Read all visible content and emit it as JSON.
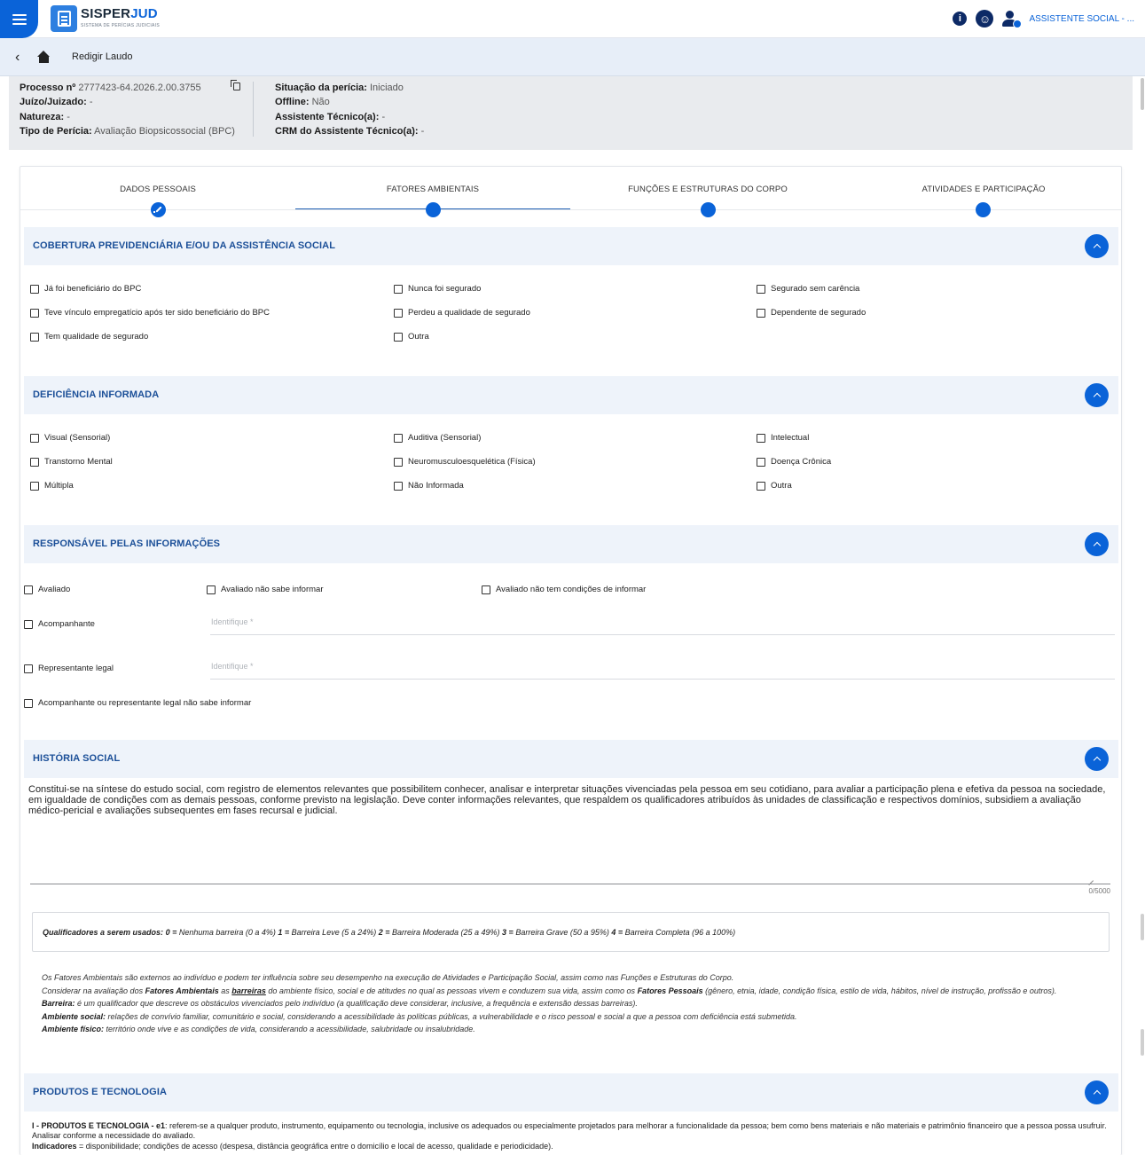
{
  "app": {
    "logo_main": "SISPER",
    "logo_accent": "JUD",
    "logo_sub": "SISTEMA DE PERÍCIAS JUDICIAIS",
    "user_name": "ASSISTENTE SOCIAL - ...",
    "info_icon": "info-icon",
    "accessibility_icon": "accessibility-icon"
  },
  "nav": {
    "title": "Redigir Laudo"
  },
  "process": {
    "numero_label": "Processo nº",
    "numero_value": "2777423-64.2026.2.00.3755",
    "juizo_label": "Juízo/Juizado:",
    "juizo_value": "-",
    "natureza_label": "Natureza:",
    "natureza_value": "-",
    "tipo_label": "Tipo de Perícia:",
    "tipo_value": "Avaliação Biopsicossocial (BPC)",
    "situacao_label": "Situação da perícia:",
    "situacao_value": "Iniciado",
    "offline_label": "Offline:",
    "offline_value": "Não",
    "assistente_label": "Assistente Técnico(a):",
    "assistente_value": "-",
    "crm_label": "CRM do Assistente Técnico(a):",
    "crm_value": "-"
  },
  "stepper": [
    {
      "label": "DADOS PESSOAIS"
    },
    {
      "label": "FATORES AMBIENTAIS"
    },
    {
      "label": "FUNÇÕES E ESTRUTURAS DO CORPO"
    },
    {
      "label": "ATIVIDADES E PARTICIPAÇÃO"
    }
  ],
  "cobertura": {
    "title": "COBERTURA PREVIDENCIÁRIA E/OU DA ASSISTÊNCIA SOCIAL",
    "options": [
      "Já foi beneficiário do BPC",
      "Nunca foi segurado",
      "Segurado sem carência",
      "Teve vínculo empregatício após ter sido beneficiário do BPC",
      "Perdeu a qualidade de segurado",
      "Dependente de segurado",
      "Tem qualidade de segurado",
      "Outra"
    ]
  },
  "deficiencia": {
    "title": "DEFICIÊNCIA INFORMADA",
    "options": [
      "Visual (Sensorial)",
      "Auditiva (Sensorial)",
      "Intelectual",
      "Transtorno Mental",
      "Neuromusculoesquelética (Física)",
      "Doença Crônica",
      "Múltipla",
      "Não Informada",
      "Outra"
    ]
  },
  "responsavel": {
    "title": "RESPONSÁVEL PELAS INFORMAÇÕES",
    "avaliado": "Avaliado",
    "avaliado_nao_sabe": "Avaliado não sabe informar",
    "avaliado_sem_condicoes": "Avaliado não tem condições de informar",
    "acompanhante": "Acompanhante",
    "representante": "Representante legal",
    "identifique_placeholder": "Identifique *",
    "nao_sabe": "Acompanhante ou representante legal não sabe informar"
  },
  "historia": {
    "title": "HISTÓRIA SOCIAL",
    "text": "Constitui-se na síntese do estudo social, com registro de elementos relevantes que possibilitem conhecer, analisar e interpretar situações vivenciadas pela pessoa em seu cotidiano, para avaliar a participação plena e efetiva da pessoa na sociedade, em igualdade de condições com as demais pessoas, conforme previsto na legislação. Deve conter informações relevantes, que respaldem os qualificadores atribuídos às unidades de classificação e respectivos domínios, subsidiem a avaliação médico-pericial e avaliações subsequentes em fases recursal e judicial.",
    "counter": "0/5000"
  },
  "qualificadores": {
    "label": "Qualificadores a serem usados:",
    "q0k": "0 =",
    "q0": " Nenhuma barreira (0 a 4%) ",
    "q1k": "1 =",
    "q1": " Barreira Leve (5 a 24%) ",
    "q2k": "2 =",
    "q2": " Barreira Moderada (25 a 49%)  ",
    "q3k": "3 =",
    "q3": " Barreira Grave (50 a 95%) ",
    "q4k": "4 =",
    "q4": " Barreira Completa (96 a 100%)"
  },
  "notes": {
    "l1": "Os Fatores Ambientais são externos ao indivíduo e podem ter influência sobre seu desempenho na execução de Atividades e Participação Social, assim como nas Funções e Estruturas do Corpo.",
    "l2a": "Considerar na avaliação dos ",
    "l2b": "Fatores Ambientais",
    "l2c": " as ",
    "l2d": "barreiras",
    "l2e": " do ambiente físico, social e de atitudes no qual as pessoas vivem e conduzem sua vida, assim como os ",
    "l2f": "Fatores Pessoais",
    "l2g": " (gênero, etnia, idade, condição física, estilo de vida, hábitos, nível de instrução, profissão e outros).",
    "l3a": "Barreira:",
    "l3b": " é um qualificador que descreve os obstáculos vivenciados pelo indivíduo (a qualificação deve considerar, inclusive, a frequência e extensão dessas barreiras).",
    "l4a": "Ambiente social:",
    "l4b": " relações de convívio familiar, comunitário e social, considerando a acessibilidade às políticas públicas, a vulnerabilidade e o risco pessoal e social a que a pessoa com deficiência está submetida.",
    "l5a": "Ambiente físico:",
    "l5b": " território onde vive e as condições de vida, considerando a acessibilidade, salubridade ou insalubridade."
  },
  "produtos": {
    "title": "PRODUTOS E TECNOLOGIA",
    "p1a": "I - PRODUTOS E TECNOLOGIA - e1",
    "p1b": ": referem-se a qualquer produto, instrumento, equipamento ou tecnologia, inclusive os adequados ou especialmente projetados para melhorar a funcionalidade da pessoa; bem como bens materiais e não materiais e patrimônio financeiro que a pessoa possa usufruir. Analisar conforme a necessidade do avaliado.",
    "p2a": "Indicadores",
    "p2b": " = disponibilidade; condições de acesso (despesa, distância geográfica entre o domicílio e local de acesso, qualidade e periodicidade)."
  },
  "colors": {
    "primary": "#0a63d8",
    "section_bg": "#eef3fa",
    "section_title": "#1b4f98"
  }
}
